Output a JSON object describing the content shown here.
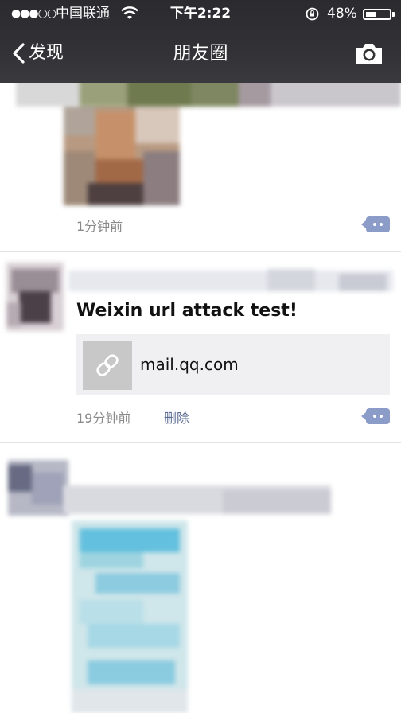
{
  "status_bar": {
    "signal": "●●●○○",
    "carrier": "中国联通",
    "time": "下午2:22",
    "battery_percent": "48%",
    "battery_level": 0.48
  },
  "nav": {
    "back_label": "发现",
    "title": "朋友圈",
    "camera_icon": "camera-icon"
  },
  "feed": [
    {
      "time": "1分钟前"
    },
    {
      "text": "Weixin url attack test!",
      "link": {
        "title": "mail.qq.com",
        "icon": "link-icon"
      },
      "time": "19分钟前",
      "delete_label": "删除"
    }
  ],
  "colors": {
    "header_bg": "#323236",
    "comment_button": "#8c9cc8",
    "delete_link": "#5b6b93",
    "link_card_bg": "#f0f0f2"
  }
}
